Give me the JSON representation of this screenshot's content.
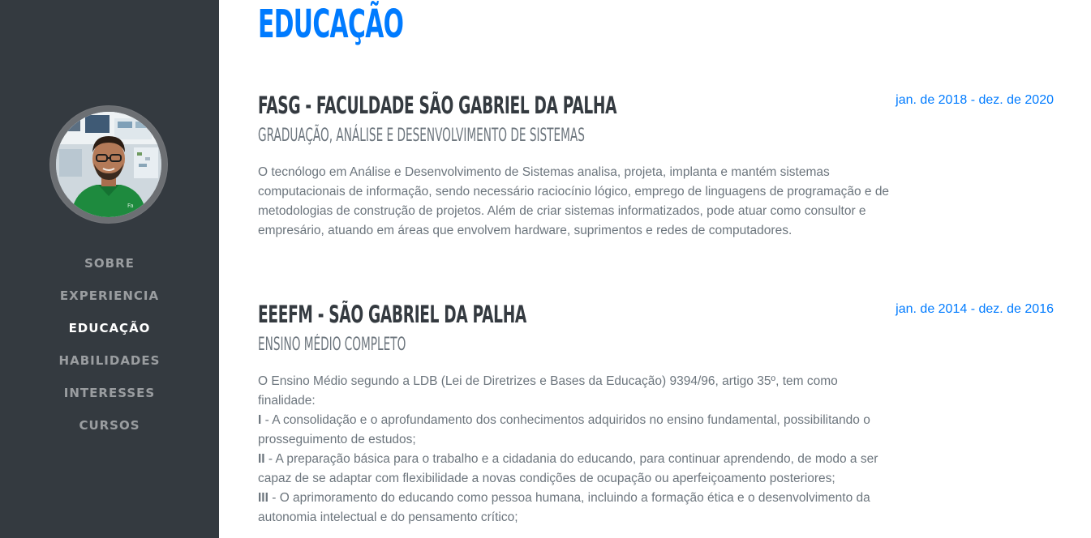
{
  "nav": {
    "items": [
      {
        "label": "Sobre",
        "active": false
      },
      {
        "label": "Experiencia",
        "active": false
      },
      {
        "label": "Educação",
        "active": true
      },
      {
        "label": "Habilidades",
        "active": false
      },
      {
        "label": "Interesses",
        "active": false
      },
      {
        "label": "Cursos",
        "active": false
      }
    ]
  },
  "section": {
    "title": "Educação"
  },
  "education": [
    {
      "school": "FASG - Faculdade São Gabriel da Palha",
      "degree": "Graduação, Análise e Desenvolvimento de Sistemas",
      "dates": "jan. de 2018 - dez. de 2020",
      "description": "O tecnólogo em Análise e Desenvolvimento de Sistemas analisa, projeta, implanta e mantém sistemas computacionais de informação, sendo necessário raciocínio lógico, emprego de linguagens de programação e de metodologias de construção de projetos. Além de criar sistemas informatizados, pode atuar como consultor e empresário, atuando em áreas que envolvem hardware, suprimentos e redes de computadores."
    },
    {
      "school": "EEEFM - São Gabriel da Palha",
      "degree": "Ensino Médio Completo",
      "dates": "jan. de 2014 - dez. de 2016",
      "intro": "O Ensino Médio segundo a LDB (Lei de Diretrizes e Bases da Educação) 9394/96, artigo 35º, tem como finalidade:",
      "points": [
        {
          "marker": "I",
          "text": " - A consolidação e o aprofundamento dos conhecimentos adquiridos no ensino fundamental, possibilitando o prosseguimento de estudos;"
        },
        {
          "marker": "II",
          "text": " - A preparação básica para o trabalho e a cidadania do educando, para continuar aprendendo, de modo a ser capaz de se adaptar com flexibilidade a novas condições de ocupação ou aperfeiçoamento posteriores;"
        },
        {
          "marker": "III",
          "text": " - O aprimoramento do educando como pessoa humana, incluindo a formação ética e o desenvolvimento da autonomia intelectual e do pensamento crítico;"
        }
      ]
    }
  ],
  "colors": {
    "sidebar": "#343a40",
    "accent": "#007bff",
    "heading": "#343a40",
    "muted": "#6c757d"
  }
}
